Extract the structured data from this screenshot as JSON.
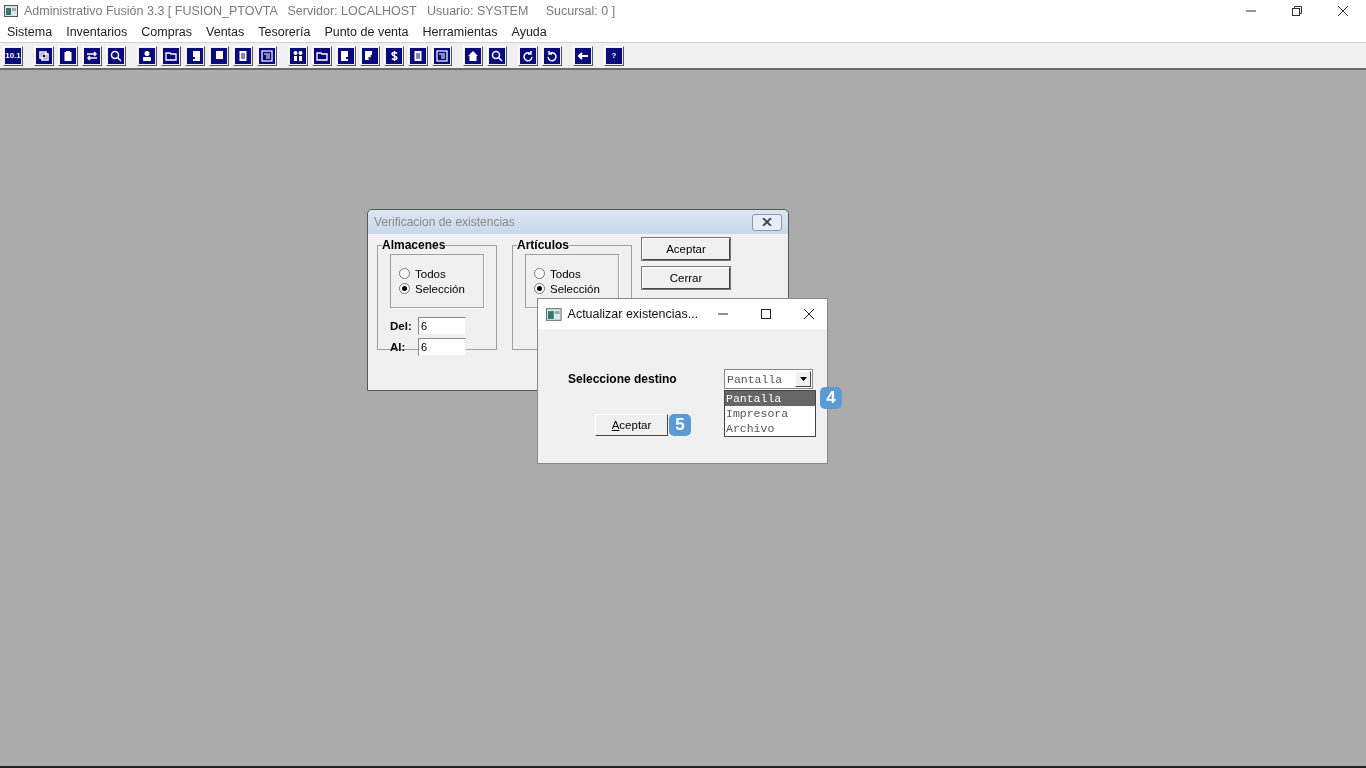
{
  "window": {
    "title": "Administrativo Fusión 3.3 [ FUSION_PTOVTA   Servidor: LOCALHOST   Usuario: SYSTEM     Sucursal: 0 ]"
  },
  "menu": [
    "Sistema",
    "Inventarios",
    "Compras",
    "Ventas",
    "Tesorería",
    "Punto de venta",
    "Herramientas",
    "Ayuda"
  ],
  "toolbar": [
    [
      {
        "kind": "text",
        "label": "10.1"
      }
    ],
    [
      {
        "kind": "copy"
      },
      {
        "kind": "clipboard"
      },
      {
        "kind": "swap"
      },
      {
        "kind": "magnifier"
      }
    ],
    [
      {
        "kind": "person"
      },
      {
        "kind": "folder"
      },
      {
        "kind": "doc-left"
      },
      {
        "kind": "doc-line"
      },
      {
        "kind": "doc"
      },
      {
        "kind": "list"
      }
    ],
    [
      {
        "kind": "people"
      },
      {
        "kind": "folder"
      },
      {
        "kind": "doc-right"
      },
      {
        "kind": "doc-plus"
      },
      {
        "kind": "dollar"
      },
      {
        "kind": "doc"
      },
      {
        "kind": "list"
      }
    ],
    [
      {
        "kind": "home"
      },
      {
        "kind": "magnifier"
      }
    ],
    [
      {
        "kind": "redo"
      },
      {
        "kind": "undo"
      }
    ],
    [
      {
        "kind": "back"
      }
    ],
    [
      {
        "kind": "text",
        "label": "?"
      }
    ]
  ],
  "verification_dialog": {
    "title": "Verificacion de existencias",
    "groups": [
      {
        "legend": "Almacenes",
        "options": [
          {
            "label": "Todos",
            "selected": false
          },
          {
            "label": "Selección",
            "selected": true
          }
        ],
        "fields": [
          {
            "label": "Del:",
            "value": "6"
          },
          {
            "label": "Al:",
            "value": "6"
          }
        ]
      },
      {
        "legend": "Artículos",
        "options": [
          {
            "label": "Todos",
            "selected": false
          },
          {
            "label": "Selección",
            "selected": true
          }
        ]
      }
    ],
    "buttons": [
      "Aceptar",
      "Cerrar"
    ]
  },
  "update_dialog": {
    "title": "Actualizar existencias...",
    "label": "Seleccione destino",
    "combo": {
      "value": "Pantalla",
      "options": [
        {
          "label": "Pantalla",
          "selected": true
        },
        {
          "label": "Impresora",
          "selected": false
        },
        {
          "label": "Archivo",
          "selected": false
        }
      ]
    },
    "button": "Aceptar",
    "callouts": [
      "4",
      "5"
    ]
  }
}
